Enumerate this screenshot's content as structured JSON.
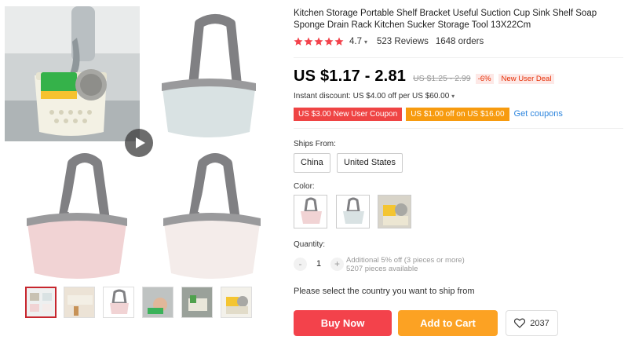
{
  "product": {
    "title": "Kitchen Storage Portable Shelf Bracket Useful Suction Cup Sink Shelf Soap Sponge Drain Rack Kitchen Sucker Storage Tool 13X22Cm",
    "rating": "4.7",
    "reviews": "523 Reviews",
    "orders": "1648 orders",
    "price": "US $1.17 - 2.81",
    "original_price": "US $1.25 - 2.99",
    "discount": "-6%",
    "deal_badge": "New User Deal",
    "instant_discount": "Instant discount: US $4.00 off per US $60.00",
    "accent_red": "#ef4444",
    "accent_orange": "#fca223"
  },
  "coupons": {
    "coupon1": "US $3.00 New User Coupon",
    "coupon2": "US $1.00 off on US $16.00",
    "get_coupons": "Get coupons"
  },
  "shipping": {
    "label": "Ships From:",
    "options": [
      "China",
      "United States"
    ]
  },
  "color": {
    "label": "Color:"
  },
  "quantity": {
    "label": "Quantity:",
    "minus": "-",
    "value": "1",
    "plus": "+",
    "info1": "Additional 5% off (3 pieces or more)",
    "info2": "5207 pieces available"
  },
  "note": "Please select the country you want to ship from",
  "actions": {
    "buy_now": "Buy Now",
    "add_to_cart": "Add to Cart",
    "wishlist_count": "2037"
  }
}
